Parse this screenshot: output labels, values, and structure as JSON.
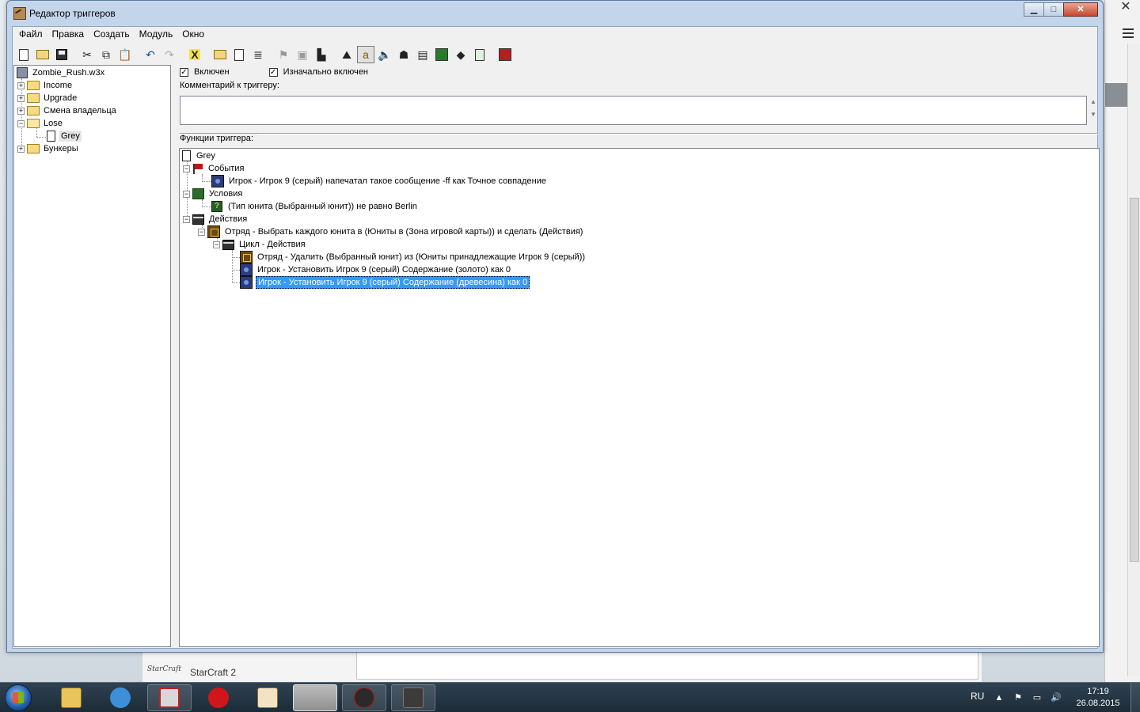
{
  "window": {
    "title": "Редактор триггеров",
    "min_label": "▁",
    "max_label": "□",
    "close_label": "✕"
  },
  "menu": [
    "Файл",
    "Правка",
    "Создать",
    "Модуль",
    "Окно"
  ],
  "toolbar_icons": [
    "new-doc-icon",
    "open-folder-icon",
    "save-icon",
    "cut-icon",
    "copy-icon",
    "paste-icon",
    "undo-icon",
    "redo-icon",
    "close-x-icon",
    "new-category-icon",
    "new-trigger-icon",
    "new-comment-icon",
    "new-event-icon",
    "new-condition-icon",
    "new-action-icon",
    "terrain-editor-icon",
    "unit-editor-icon",
    "sound-editor-icon",
    "object-editor-icon",
    "campaign-editor-icon",
    "ai-editor-icon",
    "object-manager-icon",
    "import-manager-icon",
    "test-map-icon"
  ],
  "checks": {
    "enabled_label": "Включен",
    "initially_label": "Изначально включен"
  },
  "comment": {
    "label": "Комментарий к триггеру:",
    "value": ""
  },
  "functions_label": "Функции триггера:",
  "tree": {
    "root": "Zombie_Rush.w3x",
    "items": [
      {
        "label": "Income",
        "expander": "+"
      },
      {
        "label": "Upgrade",
        "expander": "+"
      },
      {
        "label": "Смена владельца",
        "expander": "+"
      },
      {
        "label": "Lose",
        "expander": "−"
      },
      {
        "label": "Grey",
        "expander": ""
      },
      {
        "label": "Бункеры",
        "expander": "+"
      }
    ]
  },
  "trigger": {
    "name": "Grey",
    "events_label": "События",
    "event1": "Игрок - Игрок 9 (серый) напечатал такое сообщение -ff как Точное совпадение",
    "conditions_label": "Условия",
    "condition1": "(Тип юнита (Выбранный юнит)) не равно Berlin",
    "actions_label": "Действия",
    "action1": "Отряд - Выбрать каждого юнита в (Юниты в (Зона игровой карты)) и сделать (Действия)",
    "loop_label": "Цикл - Действия",
    "loop_action1": "Отряд - Удалить (Выбранный юнит) из (Юниты принадлежащие Игрок 9 (серый))",
    "loop_action2": "Игрок - Установить Игрок 9 (серый) Содержание (золото) как 0",
    "loop_action3": "Игрок - Установить Игрок 9 (серый) Содержание (древесина) как 0"
  },
  "background": {
    "sc2_logo": "StarCraft",
    "sc2_text": "StarCraft 2"
  },
  "taskbar": {
    "language": "RU",
    "time": "17:19",
    "date": "26.08.2015"
  }
}
